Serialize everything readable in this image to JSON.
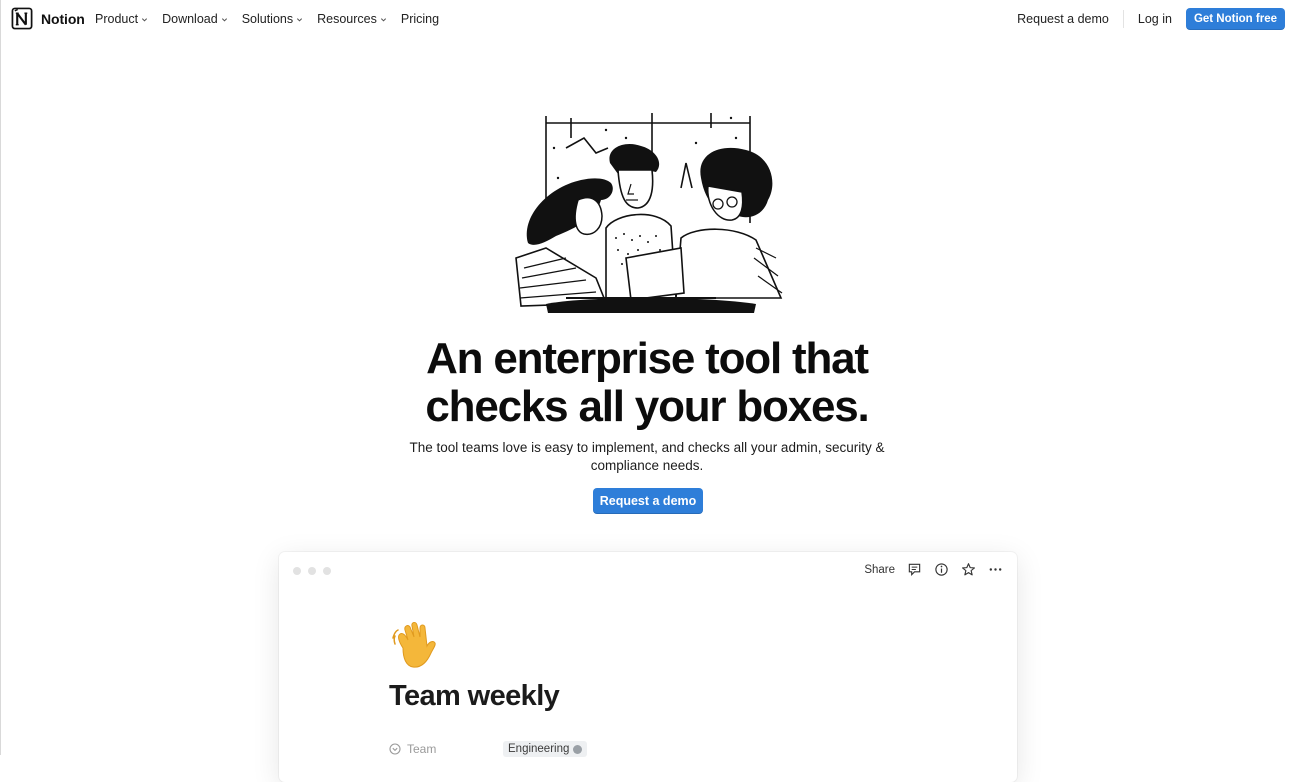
{
  "nav": {
    "brand": "Notion",
    "links": [
      "Product",
      "Download",
      "Solutions",
      "Resources",
      "Pricing"
    ],
    "request_demo": "Request a demo",
    "login": "Log in",
    "get_free": "Get Notion free"
  },
  "hero": {
    "headline_line1": "An enterprise tool that",
    "headline_line2": "checks all your boxes.",
    "subhead": "The tool teams love is easy to implement, and checks all your admin, security & compliance needs.",
    "cta": "Request a demo"
  },
  "window": {
    "share": "Share",
    "emoji": "wave",
    "doc_title": "Team weekly",
    "property_label": "Team",
    "property_value": "Engineering"
  },
  "colors": {
    "primary": "#2e7ed9",
    "text": "#111111",
    "muted": "#9a9a9a"
  }
}
